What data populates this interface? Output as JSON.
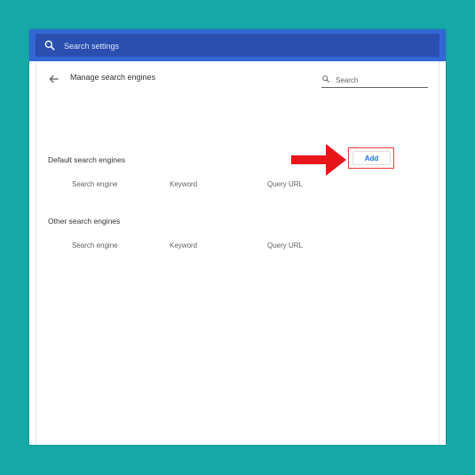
{
  "header": {
    "search_placeholder": "Search settings"
  },
  "page": {
    "title": "Manage search engines",
    "search_placeholder": "Search"
  },
  "default_section": {
    "title": "Default search engines",
    "columns": [
      "Search engine",
      "Keyword",
      "Query URL"
    ]
  },
  "other_section": {
    "title": "Other search engines",
    "columns": [
      "Search engine",
      "Keyword",
      "Query URL"
    ],
    "add_label": "Add"
  },
  "colors": {
    "background": "#16a9a8",
    "header": "#3367d6",
    "accent_blue": "#1a73e8",
    "highlight_red": "#e53935"
  },
  "icons": {
    "header_search": "search-icon",
    "back": "arrow-left-icon",
    "inner_search": "search-icon",
    "annotation": "red-arrow-icon"
  }
}
